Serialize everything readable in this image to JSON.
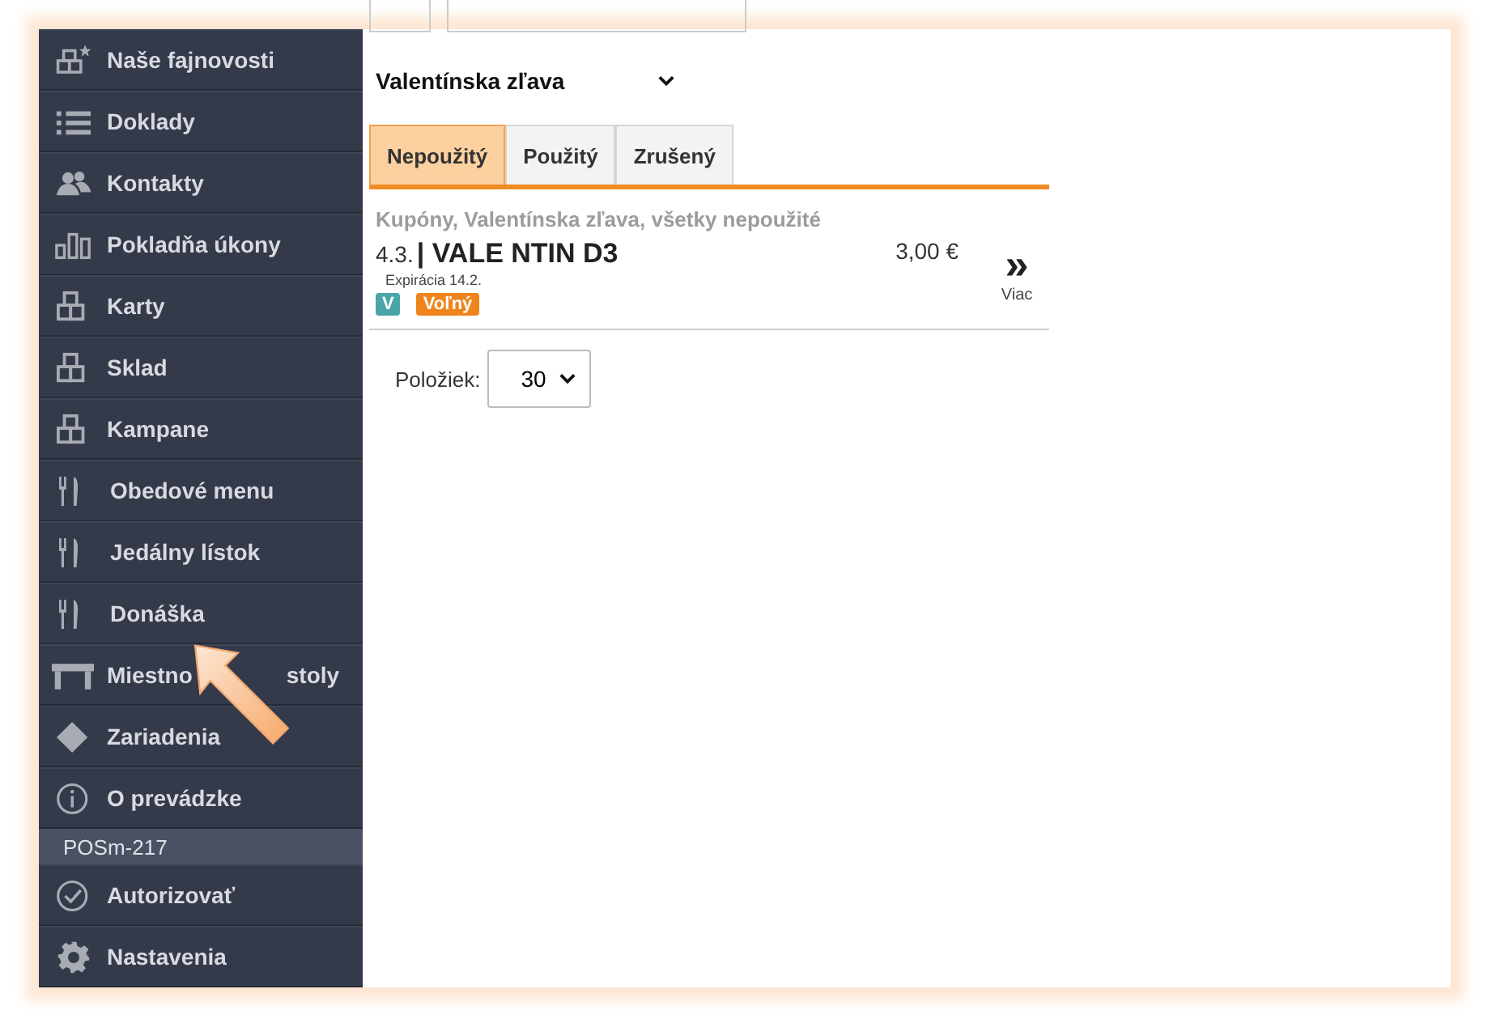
{
  "sidebar": {
    "items": [
      {
        "kind": "nav",
        "label": "Naše fajnovosti"
      },
      {
        "kind": "nav",
        "label": "Doklady"
      },
      {
        "kind": "nav",
        "label": "Kontakty"
      },
      {
        "kind": "nav",
        "label": "Pokladňa úkony"
      },
      {
        "kind": "nav",
        "label": "Karty"
      },
      {
        "kind": "nav",
        "label": "Sklad"
      },
      {
        "kind": "nav",
        "label": "Kampane"
      },
      {
        "kind": "nav",
        "label": "Obedové menu"
      },
      {
        "kind": "nav",
        "label": "Jedálny lístok"
      },
      {
        "kind": "nav",
        "label": "Donáška"
      },
      {
        "kind": "nav",
        "label": "Miestno",
        "label_end": "stoly"
      },
      {
        "kind": "nav",
        "label": "Zariadenia"
      },
      {
        "kind": "nav",
        "label": "O prevádzke"
      },
      {
        "kind": "device",
        "label": "POSm-217"
      },
      {
        "kind": "nav",
        "label": "Autorizovať"
      },
      {
        "kind": "nav",
        "label": "Nastavenia"
      }
    ]
  },
  "campaign_select": {
    "value": "Valentínska zľava"
  },
  "tabs": [
    {
      "label": "Nepoužitý",
      "selected": true
    },
    {
      "label": "Použitý",
      "selected": false
    },
    {
      "label": "Zrušený",
      "selected": false
    }
  ],
  "list_caption": "Kupóny, Valentínska zľava, všetky nepoužité",
  "coupons": [
    {
      "date": "4.3.",
      "code": "| VALE NTIN D3",
      "expiry": "Expirácia 14.2.",
      "badges": [
        {
          "text": "V",
          "color": "#4aa5a8"
        },
        {
          "text": "Voľný",
          "color": "#f0841c"
        }
      ],
      "price": "3,00 €",
      "more_icon": "»",
      "more_label": "Viac"
    }
  ],
  "page_size": {
    "label": "Položiek:",
    "value": "30"
  }
}
